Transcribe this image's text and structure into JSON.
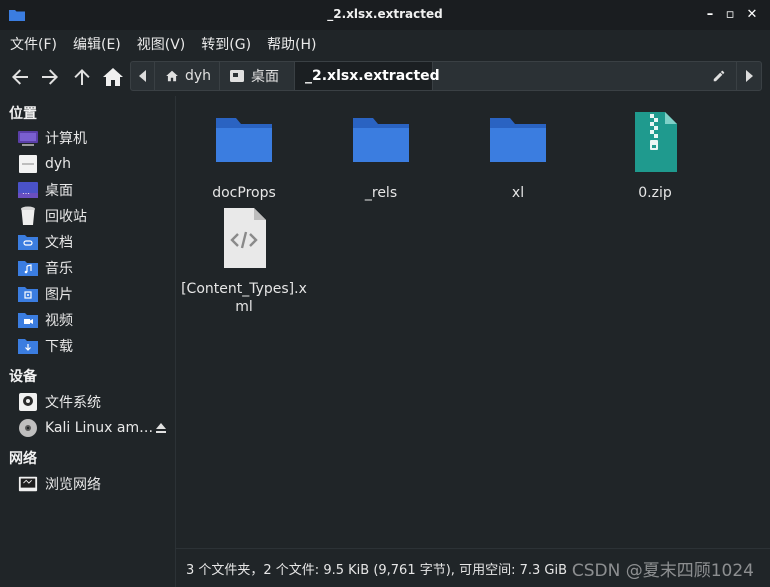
{
  "window": {
    "title": "_2.xlsx.extracted",
    "minimize_label": "–",
    "maximize_label": "▫",
    "close_label": "✕"
  },
  "menu": {
    "items": [
      {
        "label": "文件(F)"
      },
      {
        "label": "编辑(E)"
      },
      {
        "label": "视图(V)"
      },
      {
        "label": "转到(G)"
      },
      {
        "label": "帮助(H)"
      }
    ]
  },
  "toolbar": {
    "icons": [
      "back-arrow-icon",
      "forward-arrow-icon",
      "up-arrow-icon",
      "home-icon"
    ]
  },
  "pathbar": {
    "crumbs": [
      {
        "label": "dyh",
        "icon": "home-icon"
      },
      {
        "label": "桌面",
        "icon": "desktop-icon"
      },
      {
        "label": "_2.xlsx.extracted",
        "icon": ""
      }
    ]
  },
  "sidebar": {
    "places_header": "位置",
    "places": [
      {
        "label": "计算机",
        "icon": "computer-icon"
      },
      {
        "label": "dyh",
        "icon": "home-folder-icon"
      },
      {
        "label": "桌面",
        "icon": "desktop-icon"
      },
      {
        "label": "回收站",
        "icon": "trash-icon"
      },
      {
        "label": "文档",
        "icon": "documents-icon"
      },
      {
        "label": "音乐",
        "icon": "music-icon"
      },
      {
        "label": "图片",
        "icon": "pictures-icon"
      },
      {
        "label": "视频",
        "icon": "videos-icon"
      },
      {
        "label": "下载",
        "icon": "downloads-icon"
      }
    ],
    "devices_header": "设备",
    "devices": [
      {
        "label": "文件系统",
        "icon": "drive-icon"
      },
      {
        "label": "Kali Linux am…",
        "icon": "disc-icon"
      }
    ],
    "network_header": "网络",
    "network": [
      {
        "label": "浏览网络",
        "icon": "network-icon"
      }
    ]
  },
  "files": [
    {
      "name": "docProps",
      "type": "folder"
    },
    {
      "name": "_rels",
      "type": "folder"
    },
    {
      "name": "xl",
      "type": "folder"
    },
    {
      "name": "0.zip",
      "type": "zip"
    },
    {
      "name": "[Content_Types].xml",
      "type": "xml"
    }
  ],
  "status": {
    "text": "3 个文件夹，2 个文件: 9.5 KiB (9,761 字节), 可用空间: 7.3 GiB"
  },
  "watermark": "CSDN @夏末四顾1024",
  "colors": {
    "folder": "#3b7de0",
    "folder_dark": "#2a63c2",
    "zip": "#1f9a8e",
    "background": "#202528"
  }
}
